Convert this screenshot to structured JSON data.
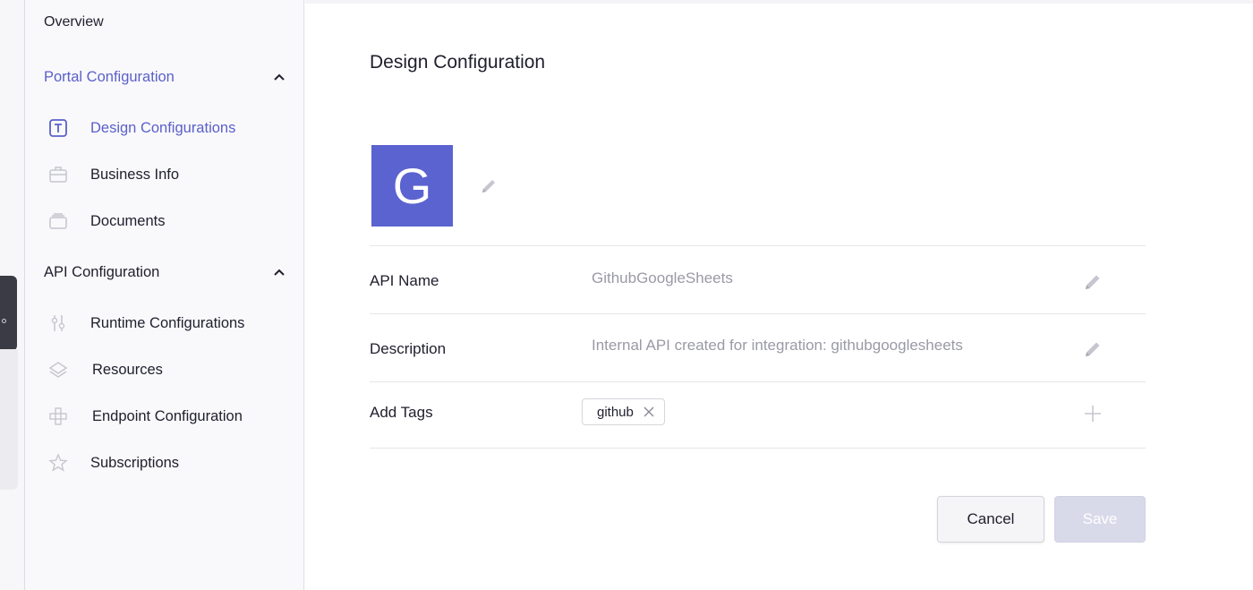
{
  "sidebar": {
    "overview": "Overview",
    "portal_section": "Portal Configuration",
    "portal_items": [
      {
        "label": "Design Configurations",
        "icon": "text-box-icon",
        "active": true
      },
      {
        "label": "Business Info",
        "icon": "briefcase-icon"
      },
      {
        "label": "Documents",
        "icon": "documents-icon"
      }
    ],
    "api_section": "API Configuration",
    "api_items": [
      {
        "label": "Runtime Configurations",
        "icon": "sliders-icon"
      },
      {
        "label": "Resources",
        "icon": "layers-icon"
      },
      {
        "label": "Endpoint Configuration",
        "icon": "endpoint-icon"
      },
      {
        "label": "Subscriptions",
        "icon": "star-icon"
      }
    ]
  },
  "main": {
    "title": "Design Configuration",
    "avatar_letter": "G",
    "fields": [
      {
        "label": "API Name",
        "value": "GithubGoogleSheets"
      },
      {
        "label": "Description",
        "value": "Internal API created for integration: githubgooglesheets"
      }
    ],
    "tags_label": "Add Tags",
    "tags": [
      "github"
    ],
    "cancel_label": "Cancel",
    "save_label": "Save"
  },
  "colors": {
    "accent": "#5b60c9",
    "avatar_bg": "#5b63d0",
    "save_disabled": "#d8daea"
  }
}
